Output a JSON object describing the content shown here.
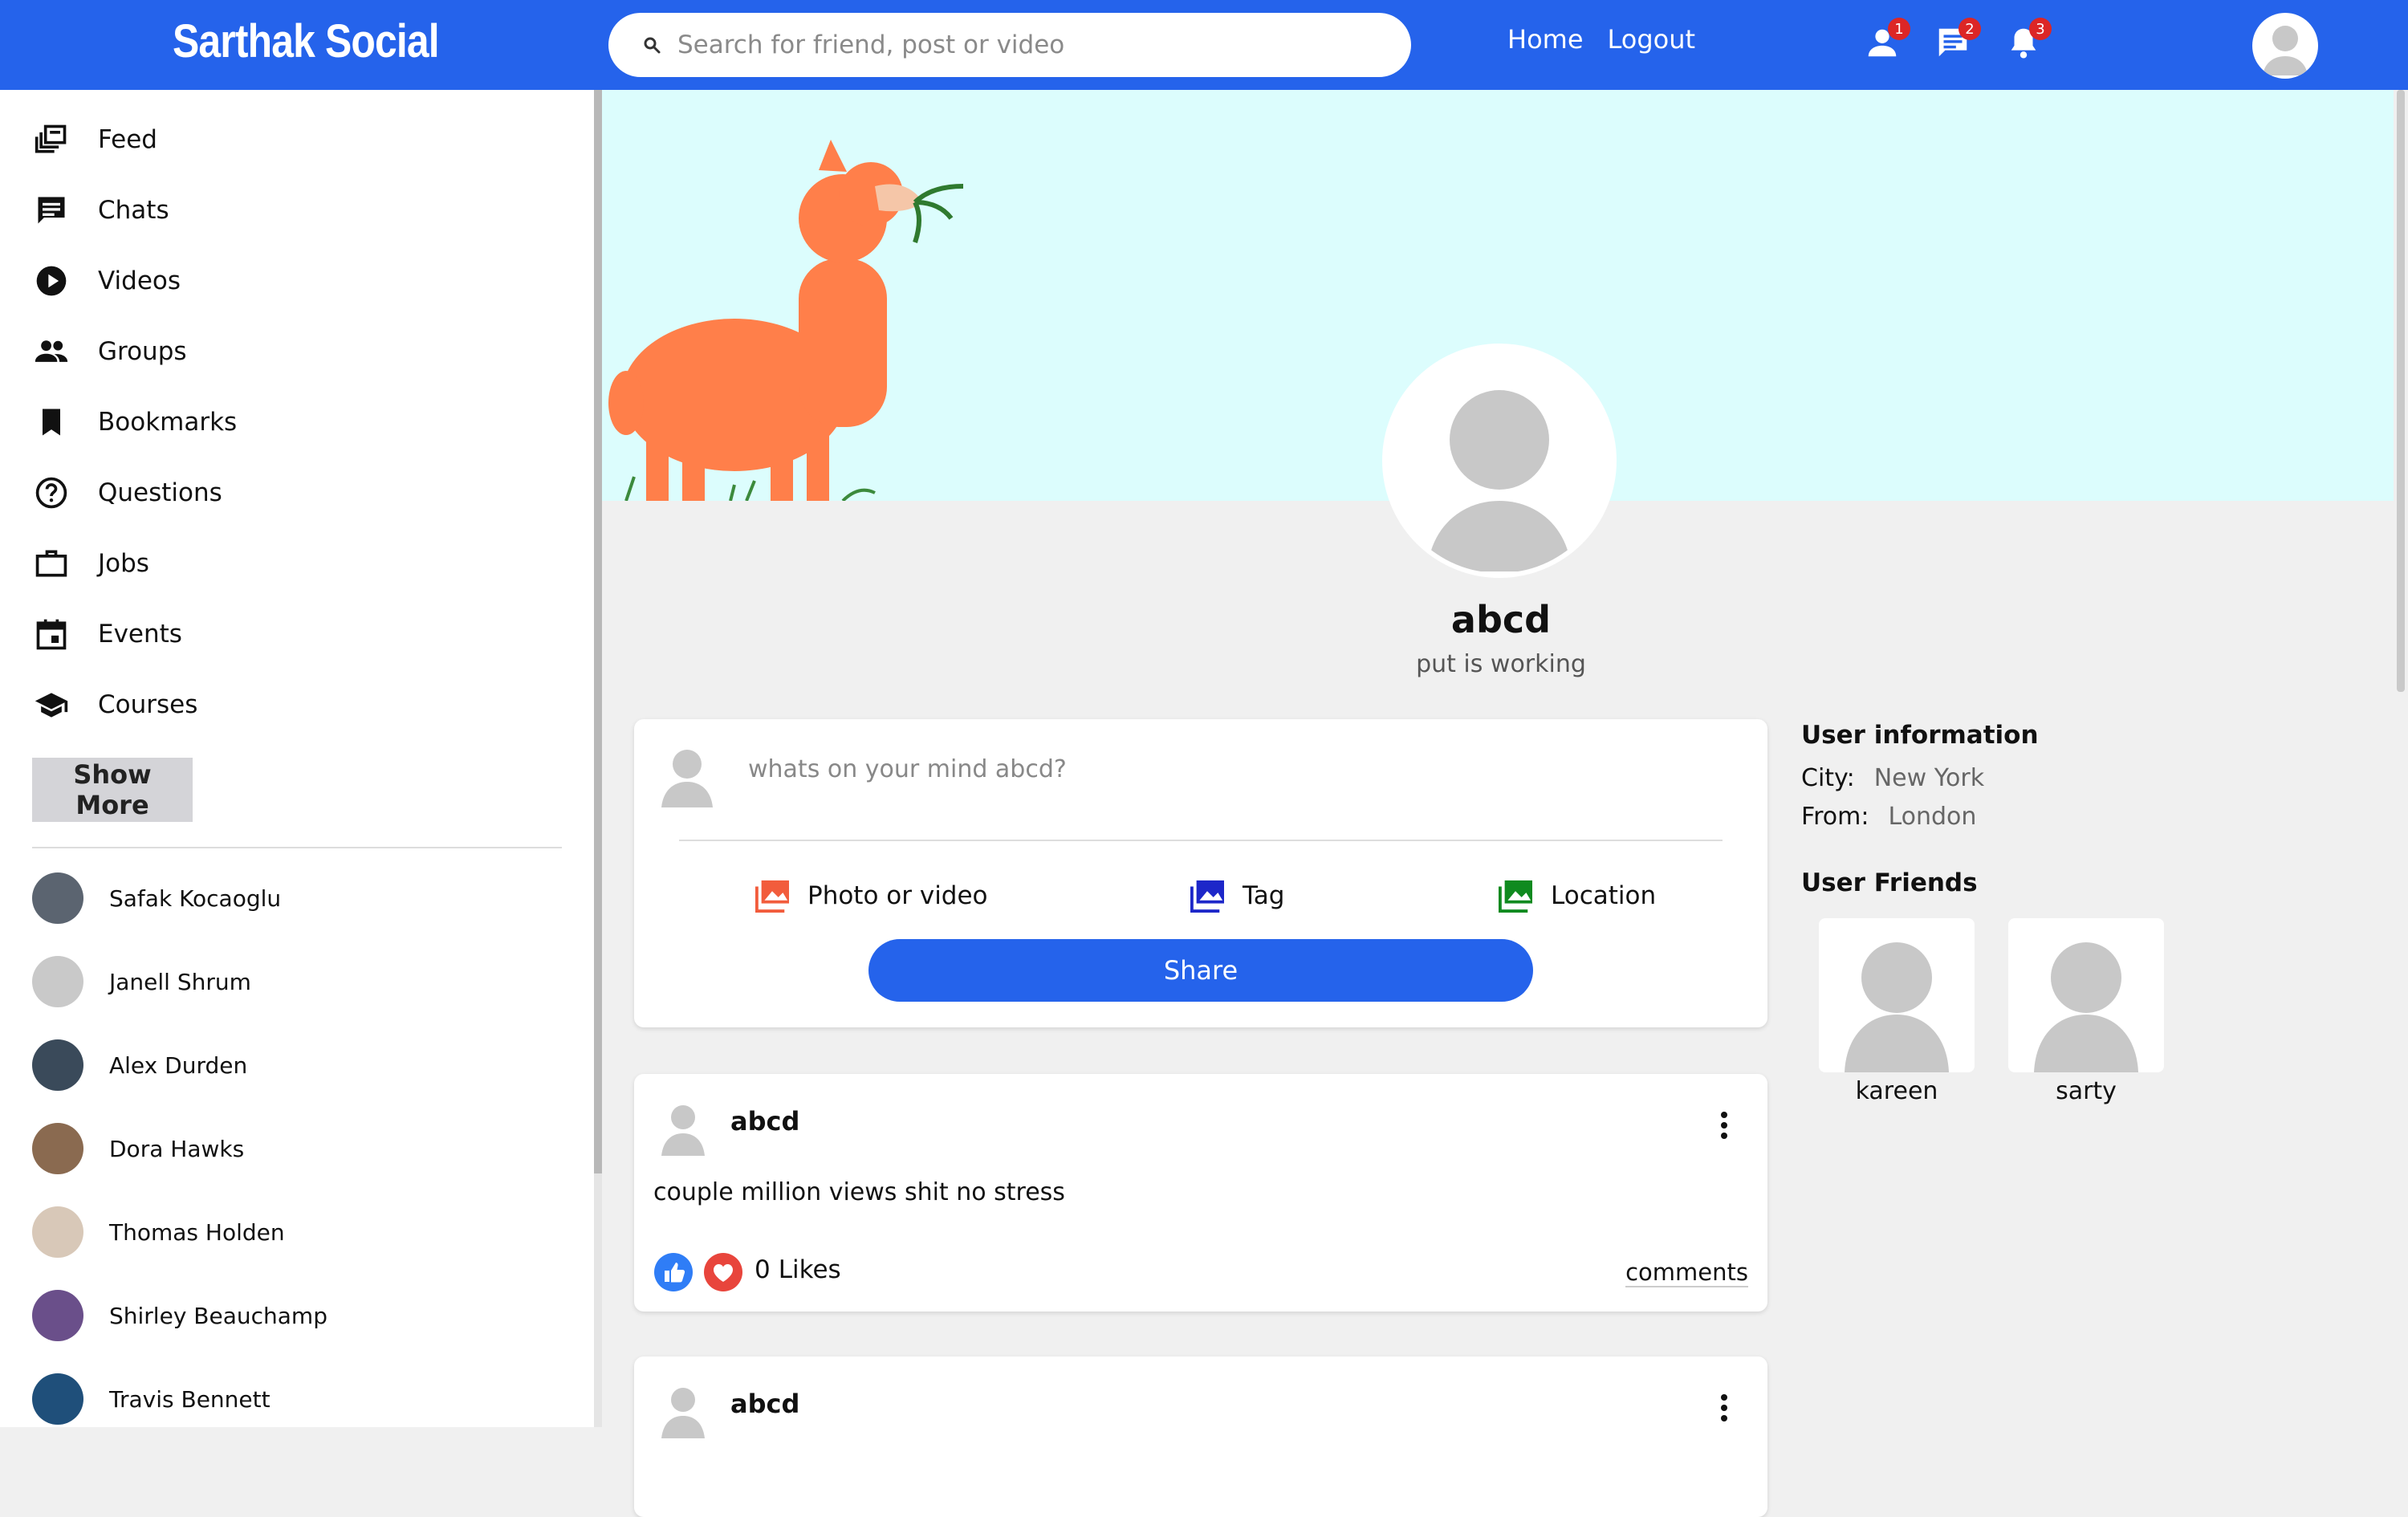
{
  "app": {
    "title": "Sarthak Social"
  },
  "search": {
    "placeholder": "Search for friend, post or video"
  },
  "nav": {
    "home": "Home",
    "logout": "Logout"
  },
  "notifications": {
    "friend_requests": "1",
    "messages": "2",
    "alerts": "3"
  },
  "sidebar": {
    "items": [
      {
        "label": "Feed",
        "icon": "feed-icon"
      },
      {
        "label": "Chats",
        "icon": "chat-icon"
      },
      {
        "label": "Videos",
        "icon": "play-circle-icon"
      },
      {
        "label": "Groups",
        "icon": "group-icon"
      },
      {
        "label": "Bookmarks",
        "icon": "bookmark-icon"
      },
      {
        "label": "Questions",
        "icon": "help-circle-icon"
      },
      {
        "label": "Jobs",
        "icon": "briefcase-icon"
      },
      {
        "label": "Events",
        "icon": "calendar-icon"
      },
      {
        "label": "Courses",
        "icon": "school-icon"
      }
    ],
    "show_more": "Show More",
    "friends": [
      {
        "name": "Safak Kocaoglu",
        "color": "#5b6470"
      },
      {
        "name": "Janell Shrum",
        "color": "#c9c9c9"
      },
      {
        "name": "Alex Durden",
        "color": "#3a4a5a"
      },
      {
        "name": "Dora Hawks",
        "color": "#8a6a50"
      },
      {
        "name": "Thomas Holden",
        "color": "#d8c8b8"
      },
      {
        "name": "Shirley Beauchamp",
        "color": "#6a4f8a"
      },
      {
        "name": "Travis Bennett",
        "color": "#1f4f7a"
      }
    ]
  },
  "profile": {
    "name": "abcd",
    "description": "put is working"
  },
  "share": {
    "placeholder": "whats on your mind abcd?",
    "photo_label": "Photo or video",
    "tag_label": "Tag",
    "location_label": "Location",
    "button": "Share"
  },
  "posts": [
    {
      "user": "abcd",
      "text": "couple million views shit no stress",
      "likes": "0",
      "likes_label": "Likes",
      "comments_label": "comments"
    },
    {
      "user": "abcd"
    }
  ],
  "user_info": {
    "title": "User information",
    "city_label": "City:",
    "city": "New York",
    "from_label": "From:",
    "from": "London",
    "friends_title": "User Friends",
    "friends": [
      {
        "name": "kareen"
      },
      {
        "name": "sarty"
      }
    ]
  },
  "colors": {
    "brand": "#2563eb",
    "badge": "#dc2626",
    "cover": "#dcfdfd",
    "photo_icon": "#f25c3c",
    "tag_icon": "#1d27c9",
    "location_icon": "#0f8a1f"
  }
}
